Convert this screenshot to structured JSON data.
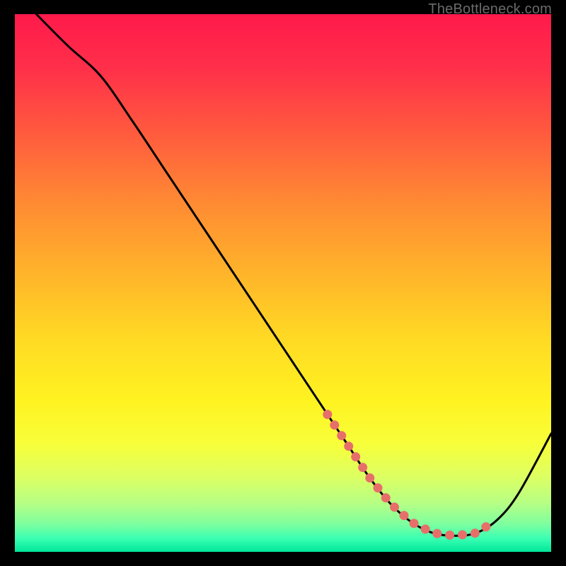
{
  "watermark": "TheBottleneck.com",
  "chart_data": {
    "type": "line",
    "title": "",
    "xlabel": "",
    "ylabel": "",
    "xlim": [
      0,
      100
    ],
    "ylim": [
      0,
      100
    ],
    "series": [
      {
        "name": "curve",
        "x": [
          4,
          10,
          16,
          22,
          28,
          34,
          40,
          46,
          52,
          58,
          62,
          66,
          70,
          74,
          78,
          82,
          86,
          90,
          94,
          100
        ],
        "y": [
          100,
          94,
          88.5,
          80,
          71,
          62,
          53,
          44,
          35,
          26,
          20,
          14,
          9,
          5.5,
          3.5,
          3,
          3.5,
          6,
          11,
          22
        ]
      }
    ],
    "dotted_segment": {
      "comment": "dotted coral segment near the valley",
      "x": [
        58,
        62,
        66,
        70,
        74,
        78,
        82,
        86,
        90
      ],
      "y": [
        26,
        20,
        14,
        9,
        5.5,
        3.5,
        3,
        3.5,
        6
      ]
    },
    "gradient_stops": [
      {
        "offset": 0.0,
        "color": "#ff1a4b"
      },
      {
        "offset": 0.1,
        "color": "#ff2f4a"
      },
      {
        "offset": 0.22,
        "color": "#ff5a3e"
      },
      {
        "offset": 0.35,
        "color": "#ff8a33"
      },
      {
        "offset": 0.48,
        "color": "#ffb32a"
      },
      {
        "offset": 0.6,
        "color": "#ffd924"
      },
      {
        "offset": 0.72,
        "color": "#fff321"
      },
      {
        "offset": 0.8,
        "color": "#f7ff3a"
      },
      {
        "offset": 0.86,
        "color": "#ddff62"
      },
      {
        "offset": 0.91,
        "color": "#b6ff85"
      },
      {
        "offset": 0.95,
        "color": "#7bffa0"
      },
      {
        "offset": 0.975,
        "color": "#3affb2"
      },
      {
        "offset": 1.0,
        "color": "#00e79a"
      }
    ],
    "colors": {
      "curve": "#000000",
      "dots": "#e76f6a"
    }
  }
}
